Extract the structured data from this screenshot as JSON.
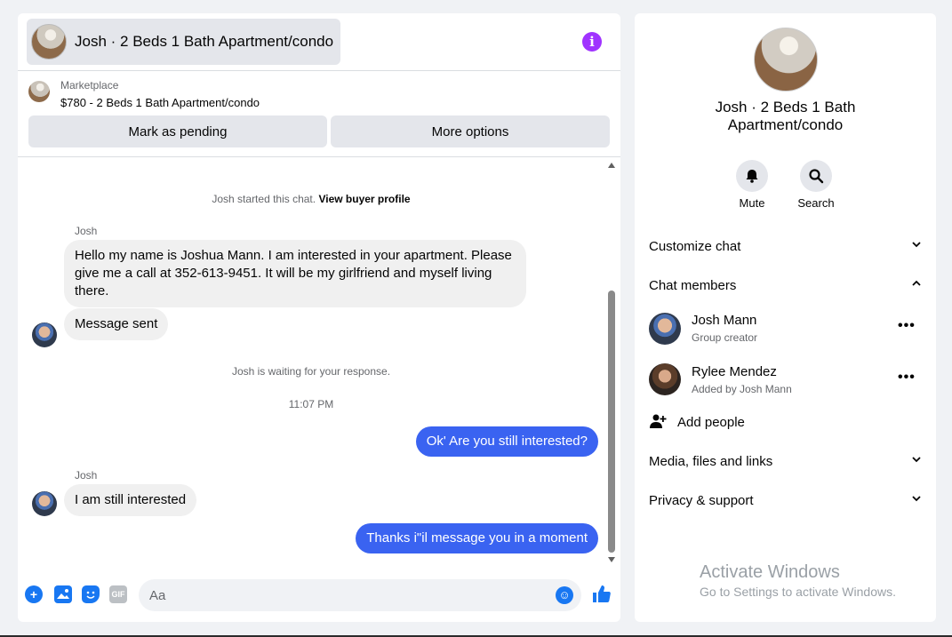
{
  "header": {
    "title": "Josh · 2 Beds 1 Bath Apartment/condo",
    "info_icon": "info-icon"
  },
  "listing": {
    "category": "Marketplace",
    "price_title": "$780 - 2 Beds 1 Bath Apartment/condo",
    "mark_pending_label": "Mark as pending",
    "more_options_label": "More options"
  },
  "messages": {
    "started_text": "Josh started this chat.",
    "view_profile_link": "View buyer profile",
    "sender_1": "Josh",
    "msg_1": "Hello my name is Joshua Mann. I am interested in your apartment. Please give me a call at 352-613-9451. It will be my girlfriend and myself living there.",
    "msg_2": "Message sent",
    "waiting_text": "Josh is waiting for your response.",
    "timestamp": "11:07 PM",
    "out_1": "Ok' Are you still interested?",
    "sender_2": "Josh",
    "msg_3": "I am still interested",
    "out_2": "Thanks i\"il message you in a moment"
  },
  "composer": {
    "placeholder": "Aa",
    "gif_label": "GIF"
  },
  "sidebar": {
    "title": "Josh · 2 Beds 1 Bath Apartment/condo",
    "mute_label": "Mute",
    "search_label": "Search",
    "customize_chat": "Customize chat",
    "chat_members": "Chat members",
    "members": [
      {
        "name": "Josh Mann",
        "role": "Group creator"
      },
      {
        "name": "Rylee Mendez",
        "role": "Added by Josh Mann"
      }
    ],
    "add_people": "Add people",
    "media_files": "Media, files and links",
    "privacy_support": "Privacy & support"
  },
  "watermark": {
    "title": "Activate Windows",
    "subtitle": "Go to Settings to activate Windows."
  },
  "colors": {
    "accent": "#1877f2",
    "outgoing_bubble": "#3a63f1",
    "info_purple": "#a033ff"
  }
}
